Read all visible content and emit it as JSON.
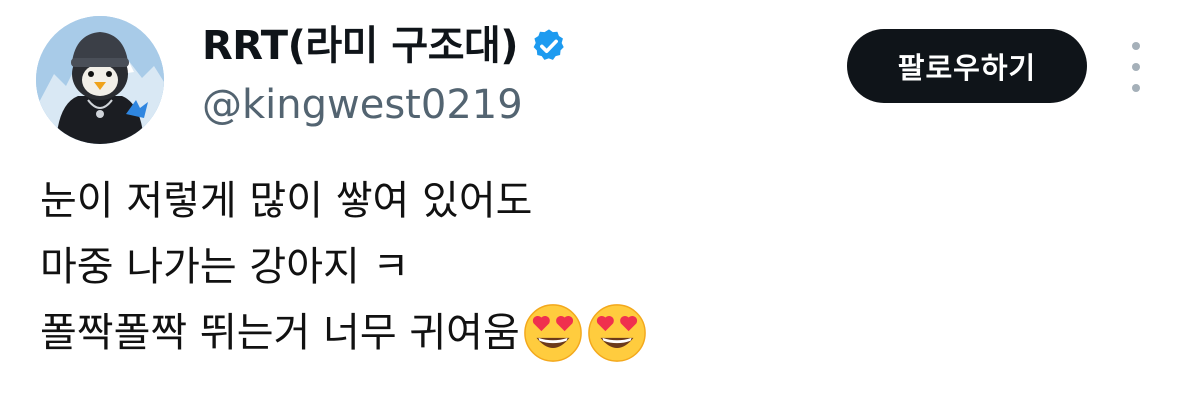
{
  "user": {
    "display_name": "RRT(라미 구조대)",
    "handle": "@kingwest0219",
    "verified": true,
    "avatar_icon": "penguin-avatar-icon"
  },
  "actions": {
    "follow_label": "팔로우하기",
    "more_icon": "more-vertical-icon"
  },
  "tweet": {
    "lines": [
      "눈이 저렇게 많이 쌓여 있어도",
      "마중 나가는 강아지 ㅋ",
      "폴짝폴짝 뛰는거 너무 귀여움"
    ],
    "emojis": [
      "heart-eyes-emoji",
      "heart-eyes-emoji"
    ]
  },
  "colors": {
    "verified_badge": "#1d9bf0",
    "follow_button": "#0f1419",
    "handle_text": "#536471"
  }
}
